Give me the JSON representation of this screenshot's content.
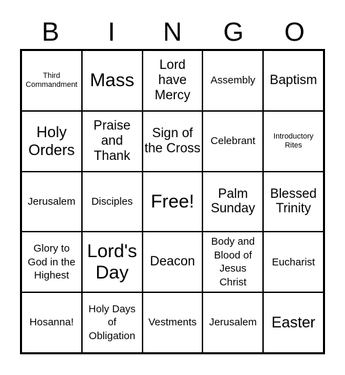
{
  "header": [
    "B",
    "I",
    "N",
    "G",
    "O"
  ],
  "cells": [
    {
      "text": "Third Commandment",
      "size": "s-xs"
    },
    {
      "text": "Mass",
      "size": "s-xl"
    },
    {
      "text": "Lord have Mercy",
      "size": "s-m"
    },
    {
      "text": "Assembly",
      "size": "s-s"
    },
    {
      "text": "Baptism",
      "size": "s-m"
    },
    {
      "text": "Holy Orders",
      "size": "s-l"
    },
    {
      "text": "Praise and Thank",
      "size": "s-m"
    },
    {
      "text": "Sign of the Cross",
      "size": "s-m"
    },
    {
      "text": "Celebrant",
      "size": "s-s"
    },
    {
      "text": "Introductory Rites",
      "size": "s-xs"
    },
    {
      "text": "Jerusalem",
      "size": "s-s"
    },
    {
      "text": "Disciples",
      "size": "s-s"
    },
    {
      "text": "Free!",
      "size": "s-xl"
    },
    {
      "text": "Palm Sunday",
      "size": "s-m"
    },
    {
      "text": "Blessed Trinity",
      "size": "s-m"
    },
    {
      "text": "Glory to God in the Highest",
      "size": "s-s"
    },
    {
      "text": "Lord's Day",
      "size": "s-xl"
    },
    {
      "text": "Deacon",
      "size": "s-m"
    },
    {
      "text": "Body and Blood of Jesus Christ",
      "size": "s-s"
    },
    {
      "text": "Eucharist",
      "size": "s-s"
    },
    {
      "text": "Hosanna!",
      "size": "s-s"
    },
    {
      "text": "Holy Days of Obligation",
      "size": "s-s"
    },
    {
      "text": "Vestments",
      "size": "s-s"
    },
    {
      "text": "Jerusalem",
      "size": "s-s"
    },
    {
      "text": "Easter",
      "size": "s-l"
    }
  ]
}
